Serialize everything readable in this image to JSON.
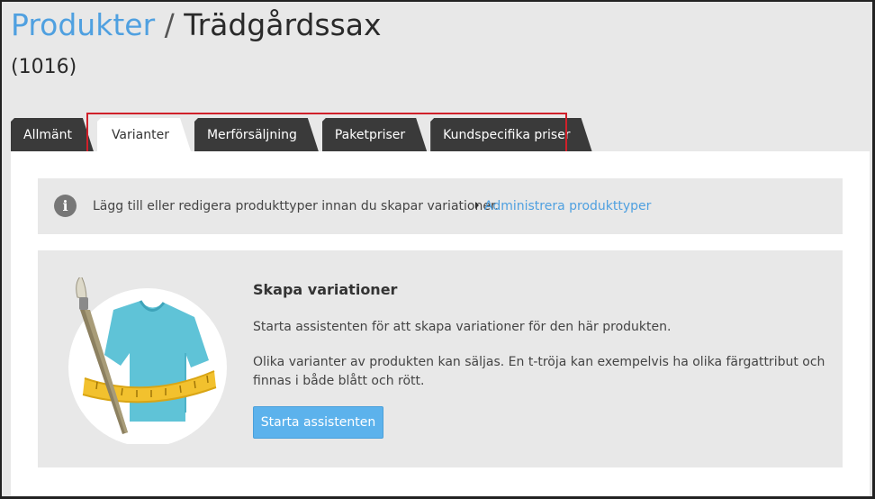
{
  "header": {
    "breadcrumb_link": "Produkter",
    "separator": "/",
    "product_name": "Trädgårdssax",
    "product_id": "(1016)"
  },
  "tabs": [
    {
      "label": "Allmänt",
      "active": false
    },
    {
      "label": "Varianter",
      "active": true
    },
    {
      "label": "Merförsäljning",
      "active": false
    },
    {
      "label": "Paketpriser",
      "active": false
    },
    {
      "label": "Kundspecifika priser",
      "active": false
    }
  ],
  "info": {
    "icon": "info-icon",
    "text": "Lägg till eller redigera produkttyper innan du skapar variationer.",
    "link": "Administrera produkttyper"
  },
  "assistant": {
    "heading": "Skapa variationer",
    "paragraph1": "Starta assistenten för att skapa variationer för den här produkten.",
    "paragraph2": "Olika varianter av produkten kan säljas. En t-tröja kan exempelvis ha olika färgattribut och finnas i både blått och rött.",
    "button": "Starta assistenten",
    "illustration": "t-shirt-with-brush-and-tape-measure"
  },
  "colors": {
    "accent": "#4fa0e0",
    "button": "#5cb2ec",
    "tab_dark": "#3a3a3a",
    "highlight": "#d0202a"
  }
}
